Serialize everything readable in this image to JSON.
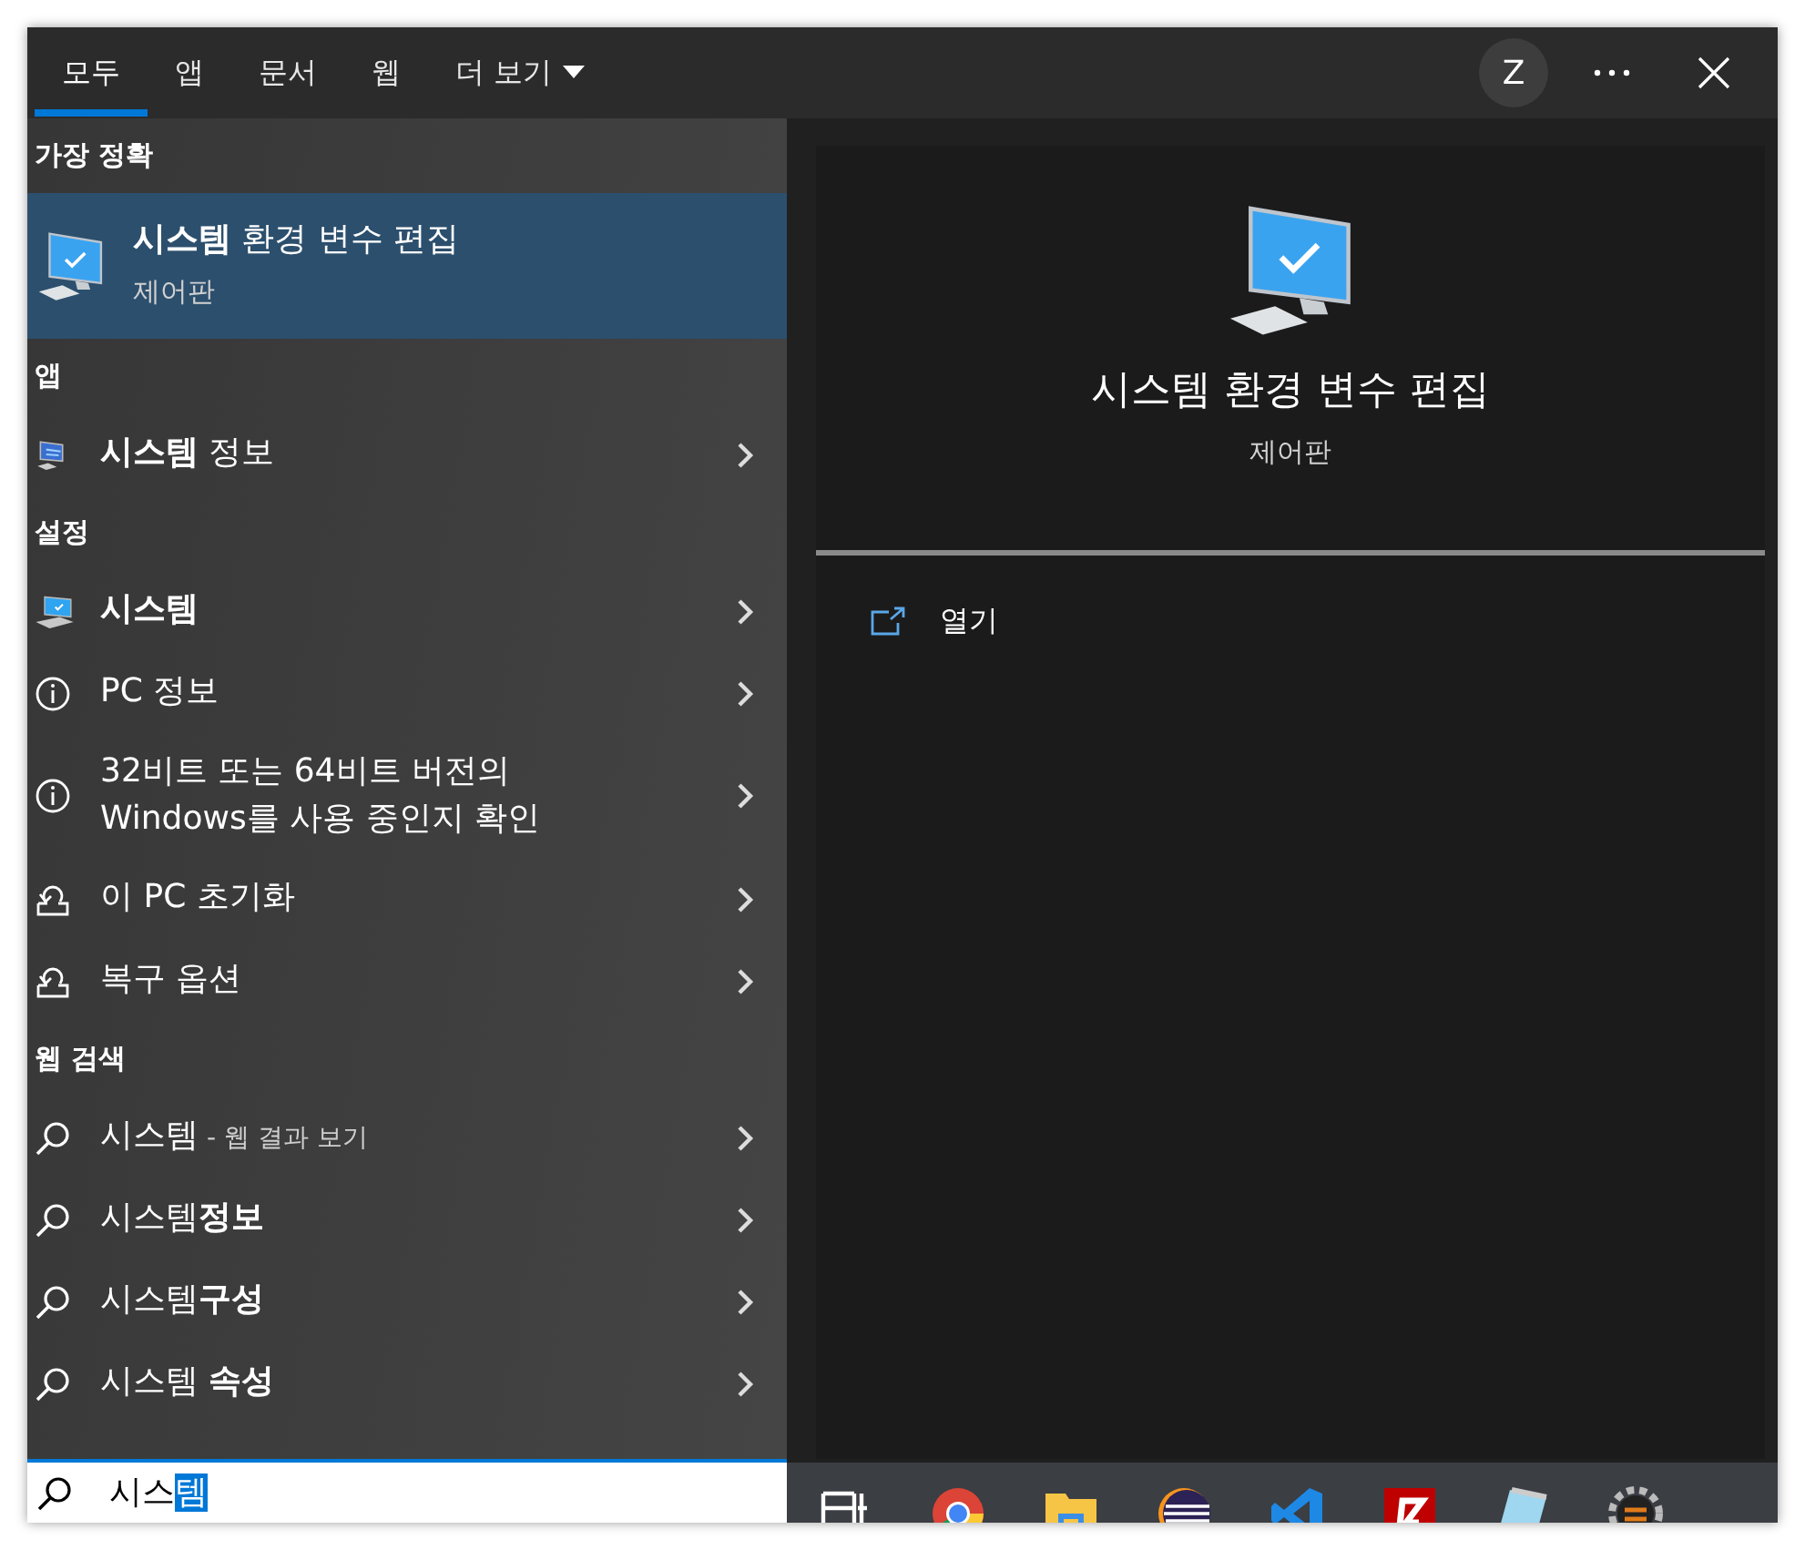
{
  "tabs": [
    {
      "label": "모두",
      "selected": true,
      "dropdown": false
    },
    {
      "label": "앱",
      "selected": false,
      "dropdown": false
    },
    {
      "label": "문서",
      "selected": false,
      "dropdown": false
    },
    {
      "label": "웹",
      "selected": false,
      "dropdown": false
    },
    {
      "label": "더 보기",
      "selected": false,
      "dropdown": true
    }
  ],
  "account": {
    "initial": "Z"
  },
  "best_match": {
    "heading": "가장 정확",
    "title": "**시스템** 환경 변수 편집",
    "subtitle": "제어판",
    "selected": true
  },
  "sections": [
    {
      "heading": "앱",
      "items": [
        {
          "kind": "sysinfo",
          "text": "**시스템** 정보"
        }
      ]
    },
    {
      "heading": "설정",
      "items": [
        {
          "kind": "laptop",
          "text": "**시스템**"
        },
        {
          "kind": "info",
          "text": "PC 정보"
        },
        {
          "kind": "info",
          "text": "32비트 또는 64비트 버전의\nWindows를 사용 중인지 확인"
        },
        {
          "kind": "reset",
          "text": "이 PC 초기화"
        },
        {
          "kind": "reset",
          "text": "복구 옵션"
        }
      ]
    },
    {
      "heading": "웹 검색",
      "items": [
        {
          "kind": "search",
          "text": "시스템",
          "suffix": "- 웹 결과 보기"
        },
        {
          "kind": "search",
          "text": "시스템**정보**"
        },
        {
          "kind": "search",
          "text": "시스템**구성**"
        },
        {
          "kind": "search",
          "text": "시스템 **속성**"
        }
      ]
    }
  ],
  "preview": {
    "title": "시스템 환경 변수 편집",
    "subtitle": "제어판",
    "actions": [
      {
        "label": "열기"
      }
    ]
  },
  "search": {
    "value": "시스",
    "selected_text": "템"
  },
  "taskbar": [
    {
      "kind": "taskview"
    },
    {
      "kind": "chrome"
    },
    {
      "kind": "folder"
    },
    {
      "kind": "eclipse"
    },
    {
      "kind": "vscode"
    },
    {
      "kind": "filezilla"
    },
    {
      "kind": "notepad"
    },
    {
      "kind": "gear"
    }
  ]
}
